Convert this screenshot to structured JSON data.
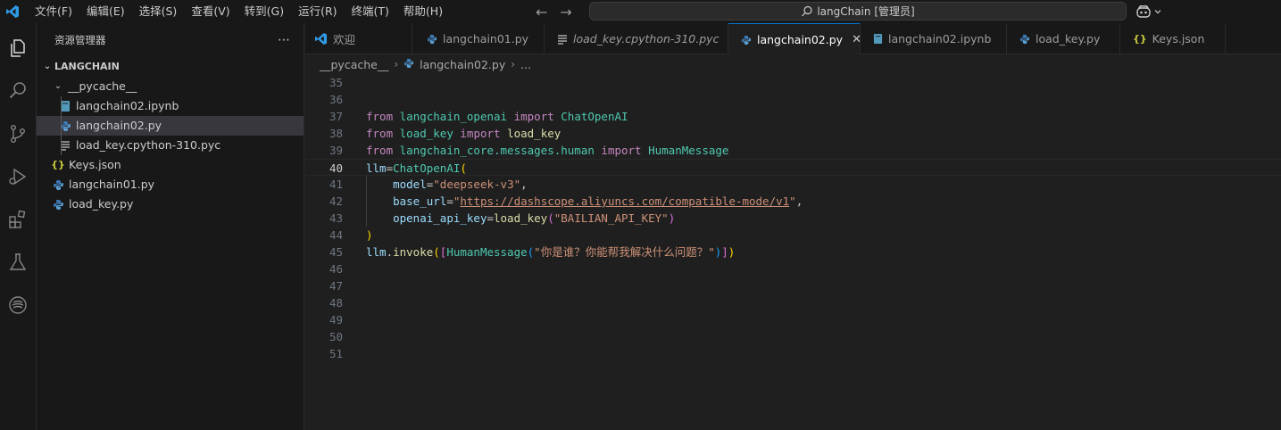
{
  "titlebar": {
    "menu": [
      "文件(F)",
      "编辑(E)",
      "选择(S)",
      "查看(V)",
      "转到(G)",
      "运行(R)",
      "终端(T)",
      "帮助(H)"
    ],
    "command_center": "langChain [管理员]"
  },
  "sidebar": {
    "title": "资源管理器",
    "section": "LANGCHAIN",
    "folder": "__pycache__",
    "folder_files": [
      "langchain02.ipynb",
      "langchain02.py",
      "load_key.cpython-310.pyc"
    ],
    "files": [
      "Keys.json",
      "langchain01.py",
      "load_key.py"
    ]
  },
  "tabs": [
    {
      "label": "欢迎",
      "icon": "vscode-icon"
    },
    {
      "label": "langchain01.py",
      "icon": "python-icon"
    },
    {
      "label": "load_key.cpython-310.pyc",
      "icon": "lines-icon"
    },
    {
      "label": "langchain02.py",
      "icon": "python-icon"
    },
    {
      "label": "langchain02.ipynb",
      "icon": "notebook-icon"
    },
    {
      "label": "load_key.py",
      "icon": "python-icon"
    },
    {
      "label": "Keys.json",
      "icon": "json-icon"
    }
  ],
  "breadcrumb": {
    "folder": "__pycache__",
    "file": "langchain02.py",
    "more": "..."
  },
  "code": {
    "line_numbers": [
      "35",
      "36",
      "37",
      "38",
      "39",
      "40",
      "41",
      "42",
      "43",
      "44",
      "45",
      "46",
      "47",
      "48",
      "49",
      "50",
      "51"
    ],
    "current_line": "40",
    "tokens": {
      "from": "from",
      "import": "import",
      "langchain_openai": "langchain_openai",
      "ChatOpenAI": "ChatOpenAI",
      "load_key": "load_key",
      "langchain_core_messages_human": "langchain_core.messages.human",
      "HumanMessage": "HumanMessage",
      "llm": "llm",
      "model": "model",
      "deepseek": "\"deepseek-v3\"",
      "base_url": "base_url",
      "url": "https://dashscope.aliyuncs.com/compatible-mode/v1",
      "quote": "\"",
      "openai_api_key": "openai_api_key",
      "bailian": "\"BAILIAN_API_KEY\"",
      "invoke": "invoke",
      "question": "\"你是谁？你能帮我解决什么问题？\""
    }
  }
}
